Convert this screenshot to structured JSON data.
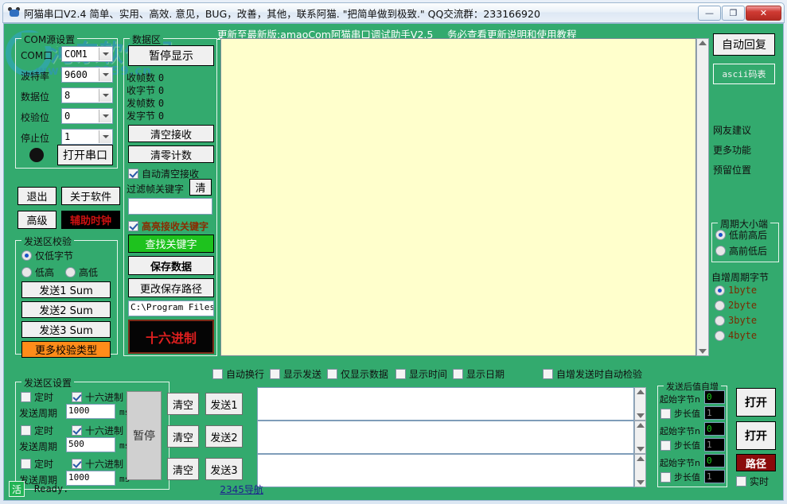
{
  "window": {
    "title": "阿猫串口V2.4  简单、实用、高效.  意见，BUG，改善，其他，联系阿猫. \"把简单做到极致.\"  QQ交流群：233166920",
    "minimize": "—",
    "maximize": "❐",
    "close": "✕",
    "app_icon": "cat-icon"
  },
  "watermark": {
    "line1": "河东软件园",
    "line2": "www.pc0359.cn"
  },
  "banner": {
    "update_text": "更新至最新版:amaoCom阿猫串口调试助手V2.5",
    "tutorial_text": "务必查看更新说明和使用教程"
  },
  "com_settings": {
    "legend": "COM源设置",
    "rows": [
      {
        "label": "COM口",
        "value": "COM1"
      },
      {
        "label": "波特率",
        "value": "9600"
      },
      {
        "label": "数据位",
        "value": "8"
      },
      {
        "label": "校验位",
        "value": "0"
      },
      {
        "label": "停止位",
        "value": "1"
      }
    ],
    "open_button": "打开串口",
    "status_led": "led-indicator"
  },
  "left_buttons": {
    "exit": "退出",
    "about": "关于软件",
    "advanced": "高级",
    "aux_clock": "辅助时钟"
  },
  "send_checksum": {
    "legend": "发送区校验",
    "radio_low_only": "仅低字节",
    "radio_low_high": "低高",
    "radio_high_low": "高低",
    "selected": "仅低字节",
    "sum1": "发送1 Sum",
    "sum2": "发送2 Sum",
    "sum3": "发送3 Sum",
    "more_types": "更多校验类型"
  },
  "data_area": {
    "legend": "数据区",
    "pause_display": "暂停显示",
    "counters": [
      {
        "label": "收帧数",
        "value": "0"
      },
      {
        "label": "收字节",
        "value": "0"
      },
      {
        "label": "发帧数",
        "value": "0"
      },
      {
        "label": "发字节",
        "value": "0"
      }
    ],
    "clear_recv": "清空接收",
    "clear_count": "清零计数",
    "auto_clear_recv": "自动清空接收",
    "auto_clear_checked": true,
    "filter_label": "过滤帧关键字",
    "filter_clear_btn": "清",
    "filter_value": "",
    "highlight_keyword": "高亮接收关键字",
    "highlight_checked": true,
    "find_keyword": "查找关键字",
    "save_data": "保存数据",
    "change_path": "更改保存路径",
    "save_path": "C:\\Program Files",
    "hex_button": "十六进制"
  },
  "right_panel": {
    "auto_reply": "自动回复",
    "ascii_table": "ascii码表",
    "links": [
      "网友建议",
      "更多功能",
      "预留位置"
    ],
    "endian": {
      "legend": "周期大小端",
      "low_first": "低前高后",
      "high_first": "高前低后",
      "selected": "低前高后"
    },
    "increment_bytes": {
      "label": "自增周期字节",
      "options": [
        "1byte",
        "2byte",
        "3byte",
        "4byte"
      ],
      "selected": "1byte"
    }
  },
  "display_options": [
    {
      "label": "自动换行",
      "checked": false
    },
    {
      "label": "显示发送",
      "checked": false
    },
    {
      "label": "仅显示数据",
      "checked": false
    },
    {
      "label": "显示时间",
      "checked": false
    },
    {
      "label": "显示日期",
      "checked": false
    }
  ],
  "auto_verify_option": {
    "label": "自增发送时自动检验",
    "checked": false
  },
  "send_settings": {
    "legend": "发送区设置",
    "rows": [
      {
        "timer_label": "定时",
        "timer_checked": false,
        "hex_label": "十六进制",
        "hex_checked": true,
        "period_label": "发送周期",
        "period_value": "1000",
        "unit": "ms",
        "clear": "清空",
        "send": "发送1",
        "text": ""
      },
      {
        "timer_label": "定时",
        "timer_checked": false,
        "hex_label": "十六进制",
        "hex_checked": true,
        "period_label": "发送周期",
        "period_value": "500",
        "unit": "ms",
        "clear": "清空",
        "send": "发送2",
        "text": ""
      },
      {
        "timer_label": "定时",
        "timer_checked": false,
        "hex_label": "十六进制",
        "hex_checked": true,
        "period_label": "发送周期",
        "period_value": "1000",
        "unit": "ms",
        "clear": "清空",
        "send": "发送3",
        "text": ""
      }
    ],
    "pause_button": "暂停"
  },
  "auto_increment": {
    "legend": "发送后值自增",
    "rows": [
      {
        "start_label": "起始字节n",
        "start_value": "0",
        "step_label": "步长值",
        "step_value": "1",
        "step_checked": false
      },
      {
        "start_label": "起始字节n",
        "start_value": "0",
        "step_label": "步长值",
        "step_value": "1",
        "step_checked": false
      },
      {
        "start_label": "起始字节n",
        "start_value": "0",
        "step_label": "步长值",
        "step_value": "1",
        "step_checked": false
      }
    ]
  },
  "file_panel": {
    "open1": "打开",
    "open2": "打开",
    "path": "路径",
    "realtime": "实时",
    "realtime_checked": false
  },
  "statusbar": {
    "icon_text": "活",
    "ready": "Ready.",
    "nav_link": "2345导航"
  },
  "colors": {
    "client_green": "#33aa6e",
    "recv_bg": "#FFFFCC",
    "accent_green_btn": "#1ec21e",
    "accent_orange": "#ff8c1a",
    "accent_dark_red": "#8a0b0b"
  }
}
